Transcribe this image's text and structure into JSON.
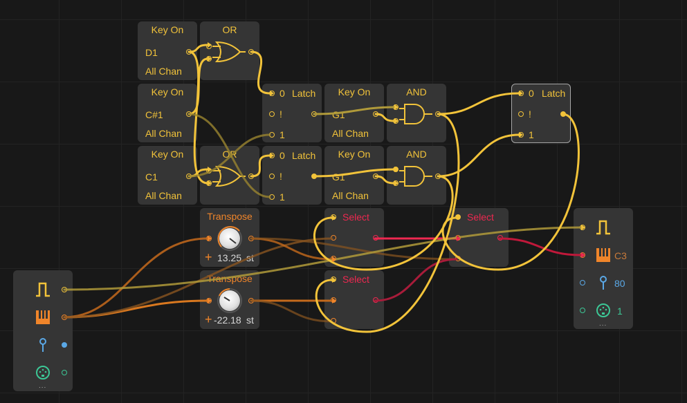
{
  "nodes": {
    "keyon1": {
      "title": "Key On",
      "note": "D1",
      "channel": "All Chan"
    },
    "or1": {
      "title": "OR"
    },
    "keyon2": {
      "title": "Key On",
      "note": "C#1",
      "channel": "All Chan"
    },
    "keyon3": {
      "title": "Key On",
      "note": "C1",
      "channel": "All Chan"
    },
    "or2": {
      "title": "OR"
    },
    "latch1": {
      "title": "Latch",
      "in0": "0",
      "in1": "!",
      "in2": "1"
    },
    "latch2": {
      "title": "Latch",
      "in0": "0",
      "in1": "!",
      "in2": "1"
    },
    "latch3": {
      "title": "Latch",
      "in0": "0",
      "in1": "!",
      "in2": "1"
    },
    "keyon4": {
      "title": "Key On",
      "note": "G1",
      "channel": "All Chan"
    },
    "keyon5": {
      "title": "Key On",
      "note": "G1",
      "channel": "All Chan"
    },
    "and1": {
      "title": "AND"
    },
    "and2": {
      "title": "AND"
    },
    "transpose1": {
      "title": "Transpose",
      "sign": "+",
      "value": "13.25",
      "unit": "st"
    },
    "transpose2": {
      "title": "Transpose",
      "sign": "+",
      "value": "-22.18",
      "unit": "st"
    },
    "select1": {
      "title": "Select"
    },
    "select2": {
      "title": "Select"
    },
    "select3": {
      "title": "Select"
    },
    "note_in": {
      "more": "..."
    },
    "note_out": {
      "pitch": "C3",
      "velocity": "80",
      "channel": "1",
      "more": "..."
    }
  },
  "colors": {
    "gate": "#f2c33a",
    "note": "#f0852a",
    "select": "#ee2850",
    "velocity": "#5aa8e6",
    "channel": "#3cc896"
  },
  "icons": [
    "gate-pulse-icon",
    "piano-keys-icon",
    "velocity-pin-icon",
    "midi-channel-icon",
    "and-gate-icon",
    "or-gate-icon",
    "knob-icon"
  ]
}
